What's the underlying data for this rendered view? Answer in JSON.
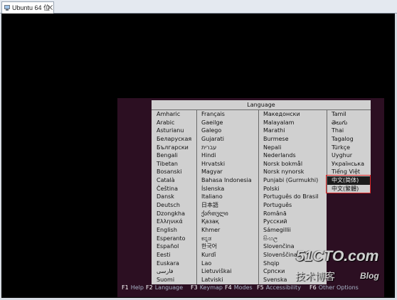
{
  "window": {
    "tab_title": "Ubuntu 64 位"
  },
  "dialog": {
    "title": "Language",
    "columns": [
      [
        "Amharic",
        "Arabic",
        "Asturianu",
        "Беларуская",
        "Български",
        "Bengali",
        "Tibetan",
        "Bosanski",
        "Català",
        "Čeština",
        "Dansk",
        "Deutsch",
        "Dzongkha",
        "Ελληνικά",
        "English",
        "Esperanto",
        "Español",
        "Eesti",
        "Euskara",
        "فارسی",
        "Suomi"
      ],
      [
        "Français",
        "Gaeilge",
        "Galego",
        "Gujarati",
        "עברית",
        "Hindi",
        "Hrvatski",
        "Magyar",
        "Bahasa Indonesia",
        "Íslenska",
        "Italiano",
        "日本語",
        "ქართული",
        "Қазақ",
        "Khmer",
        "ಕನ್ನಡ",
        "한국어",
        "Kurdî",
        "Lao",
        "Lietuviškai",
        "Latviski"
      ],
      [
        "Македонски",
        "Malayalam",
        "Marathi",
        "Burmese",
        "Nepali",
        "Nederlands",
        "Norsk bokmål",
        "Norsk nynorsk",
        "Punjabi (Gurmukhi)",
        "Polski",
        "Português do Brasil",
        "Português",
        "Română",
        "Русский",
        "Sámegillii",
        "සිංහල",
        "Slovenčina",
        "Slovenščina",
        "Shqip",
        "Српски",
        "Svenska"
      ],
      [
        "Tamil",
        "తెలుగు",
        "Thai",
        "Tagalog",
        "Türkçe",
        "Uyghur",
        "Українська",
        "Tiếng Việt",
        "中文(简体)",
        "中文(繁體)"
      ]
    ],
    "selected": {
      "column": 3,
      "row": 8
    }
  },
  "function_keys": [
    {
      "key": "F1",
      "label": "Help"
    },
    {
      "key": "F2",
      "label": "Language"
    },
    {
      "key": "F3",
      "label": "Keymap"
    },
    {
      "key": "F4",
      "label": "Modes"
    },
    {
      "key": "F5",
      "label": "Accessibility"
    },
    {
      "key": "F6",
      "label": "Other Options"
    }
  ],
  "watermark": {
    "site": "51CTO.com",
    "subtitle": "技术博客",
    "blog": "Blog"
  },
  "colors": {
    "console_bg": "#000000",
    "boot_panel_bg": "#2c0f22",
    "dialog_bg": "#d0d0d0",
    "selection_bg": "#1b1b1b",
    "annotation": "#e02a2a"
  }
}
